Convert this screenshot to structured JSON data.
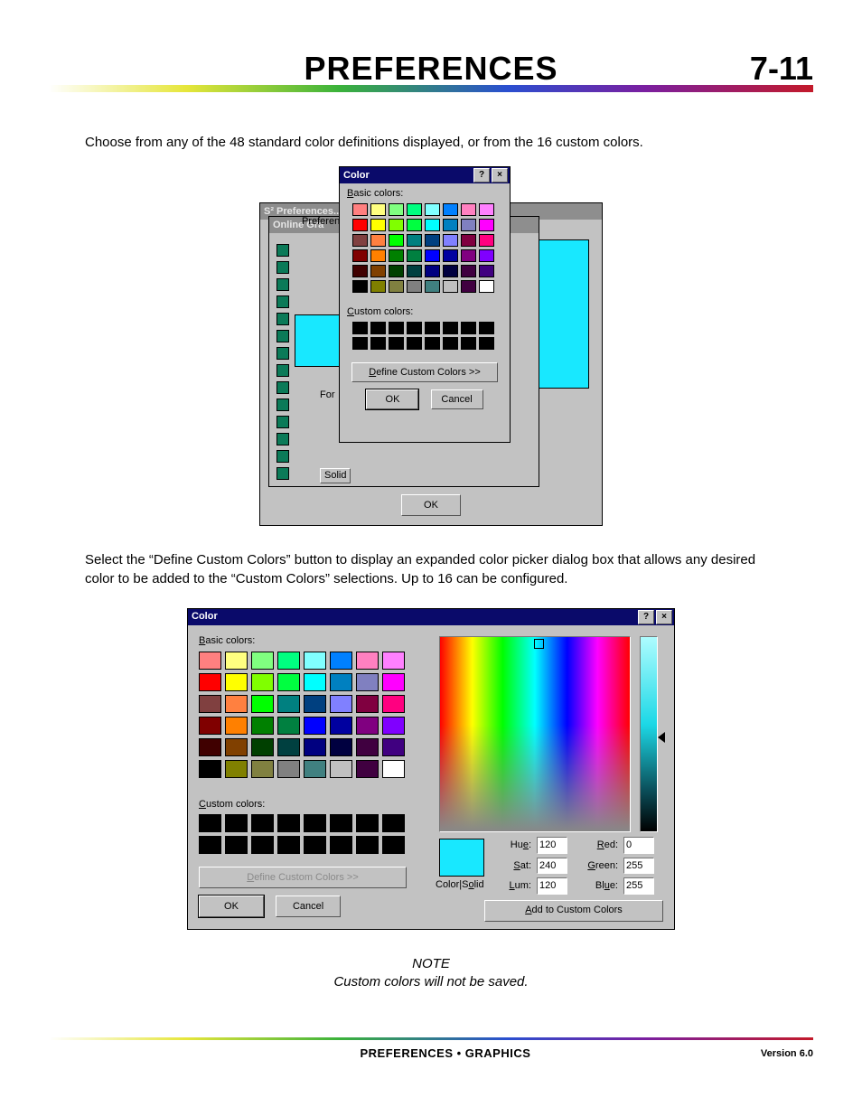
{
  "header": {
    "title": "PREFERENCES",
    "page": "7-11"
  },
  "intro": "Choose from any of the 48 standard color definitions displayed, or from the 16 custom colors.",
  "para2": "Select the “Define Custom Colors” button to display an expanded color picker dialog box that allows any desired color to be added to the “Custom Colors” selections.  Up to 16 can be configured.",
  "note": {
    "label": "NOTE",
    "text": "Custom colors will not be saved."
  },
  "footer": {
    "section": "PREFERENCES • GRAPHICS",
    "version": "Version 6.0"
  },
  "dlg": {
    "title": "Color",
    "basic_label_pre": "B",
    "basic_label_u": "asic colors:",
    "custom_label_pre": "C",
    "custom_label_u": "ustom colors:",
    "define_pre": "D",
    "define_rest": "efine Custom Colors >>",
    "ok": "OK",
    "cancel": "Cancel",
    "add": "Add to Custom Colors",
    "colorsolid_pre": "Color|S",
    "colorsolid_u": "o",
    "colorsolid_post": "lid",
    "hue_l": "Hu",
    "hue_u": "e",
    "hue_post": ":",
    "hue_v": "120",
    "sat_l": "",
    "sat_u": "S",
    "sat_post": "at:",
    "sat_v": "240",
    "lum_l": "",
    "lum_u": "L",
    "lum_post": "um:",
    "lum_v": "120",
    "red_l": "",
    "red_u": "R",
    "red_post": "ed:",
    "red_v": "0",
    "grn_l": "",
    "grn_u": "G",
    "grn_post": "reen:",
    "grn_v": "255",
    "blu_l": "Bl",
    "blu_u": "u",
    "blu_post": "e:",
    "blu_v": "255"
  },
  "bgwin": {
    "title": "S² Preferences..",
    "tab": "Preference",
    "tab2": "Online Gra",
    "for": "For",
    "solid": "Solid"
  },
  "preview_color": "#18e8ff",
  "basic_colors": [
    "#ff8080",
    "#ffff80",
    "#80ff80",
    "#00ff80",
    "#80ffff",
    "#0080ff",
    "#ff80c0",
    "#ff80ff",
    "#ff0000",
    "#ffff00",
    "#80ff00",
    "#00ff40",
    "#00ffff",
    "#0080c0",
    "#8080c0",
    "#ff00ff",
    "#804040",
    "#ff8040",
    "#00ff00",
    "#008080",
    "#004080",
    "#8080ff",
    "#800040",
    "#ff0080",
    "#800000",
    "#ff8000",
    "#008000",
    "#008040",
    "#0000ff",
    "#0000a0",
    "#800080",
    "#8000ff",
    "#400000",
    "#804000",
    "#004000",
    "#004040",
    "#000080",
    "#000040",
    "#400040",
    "#400080",
    "#000000",
    "#808000",
    "#808040",
    "#808080",
    "#408080",
    "#c0c0c0",
    "#400040",
    "#ffffff"
  ]
}
